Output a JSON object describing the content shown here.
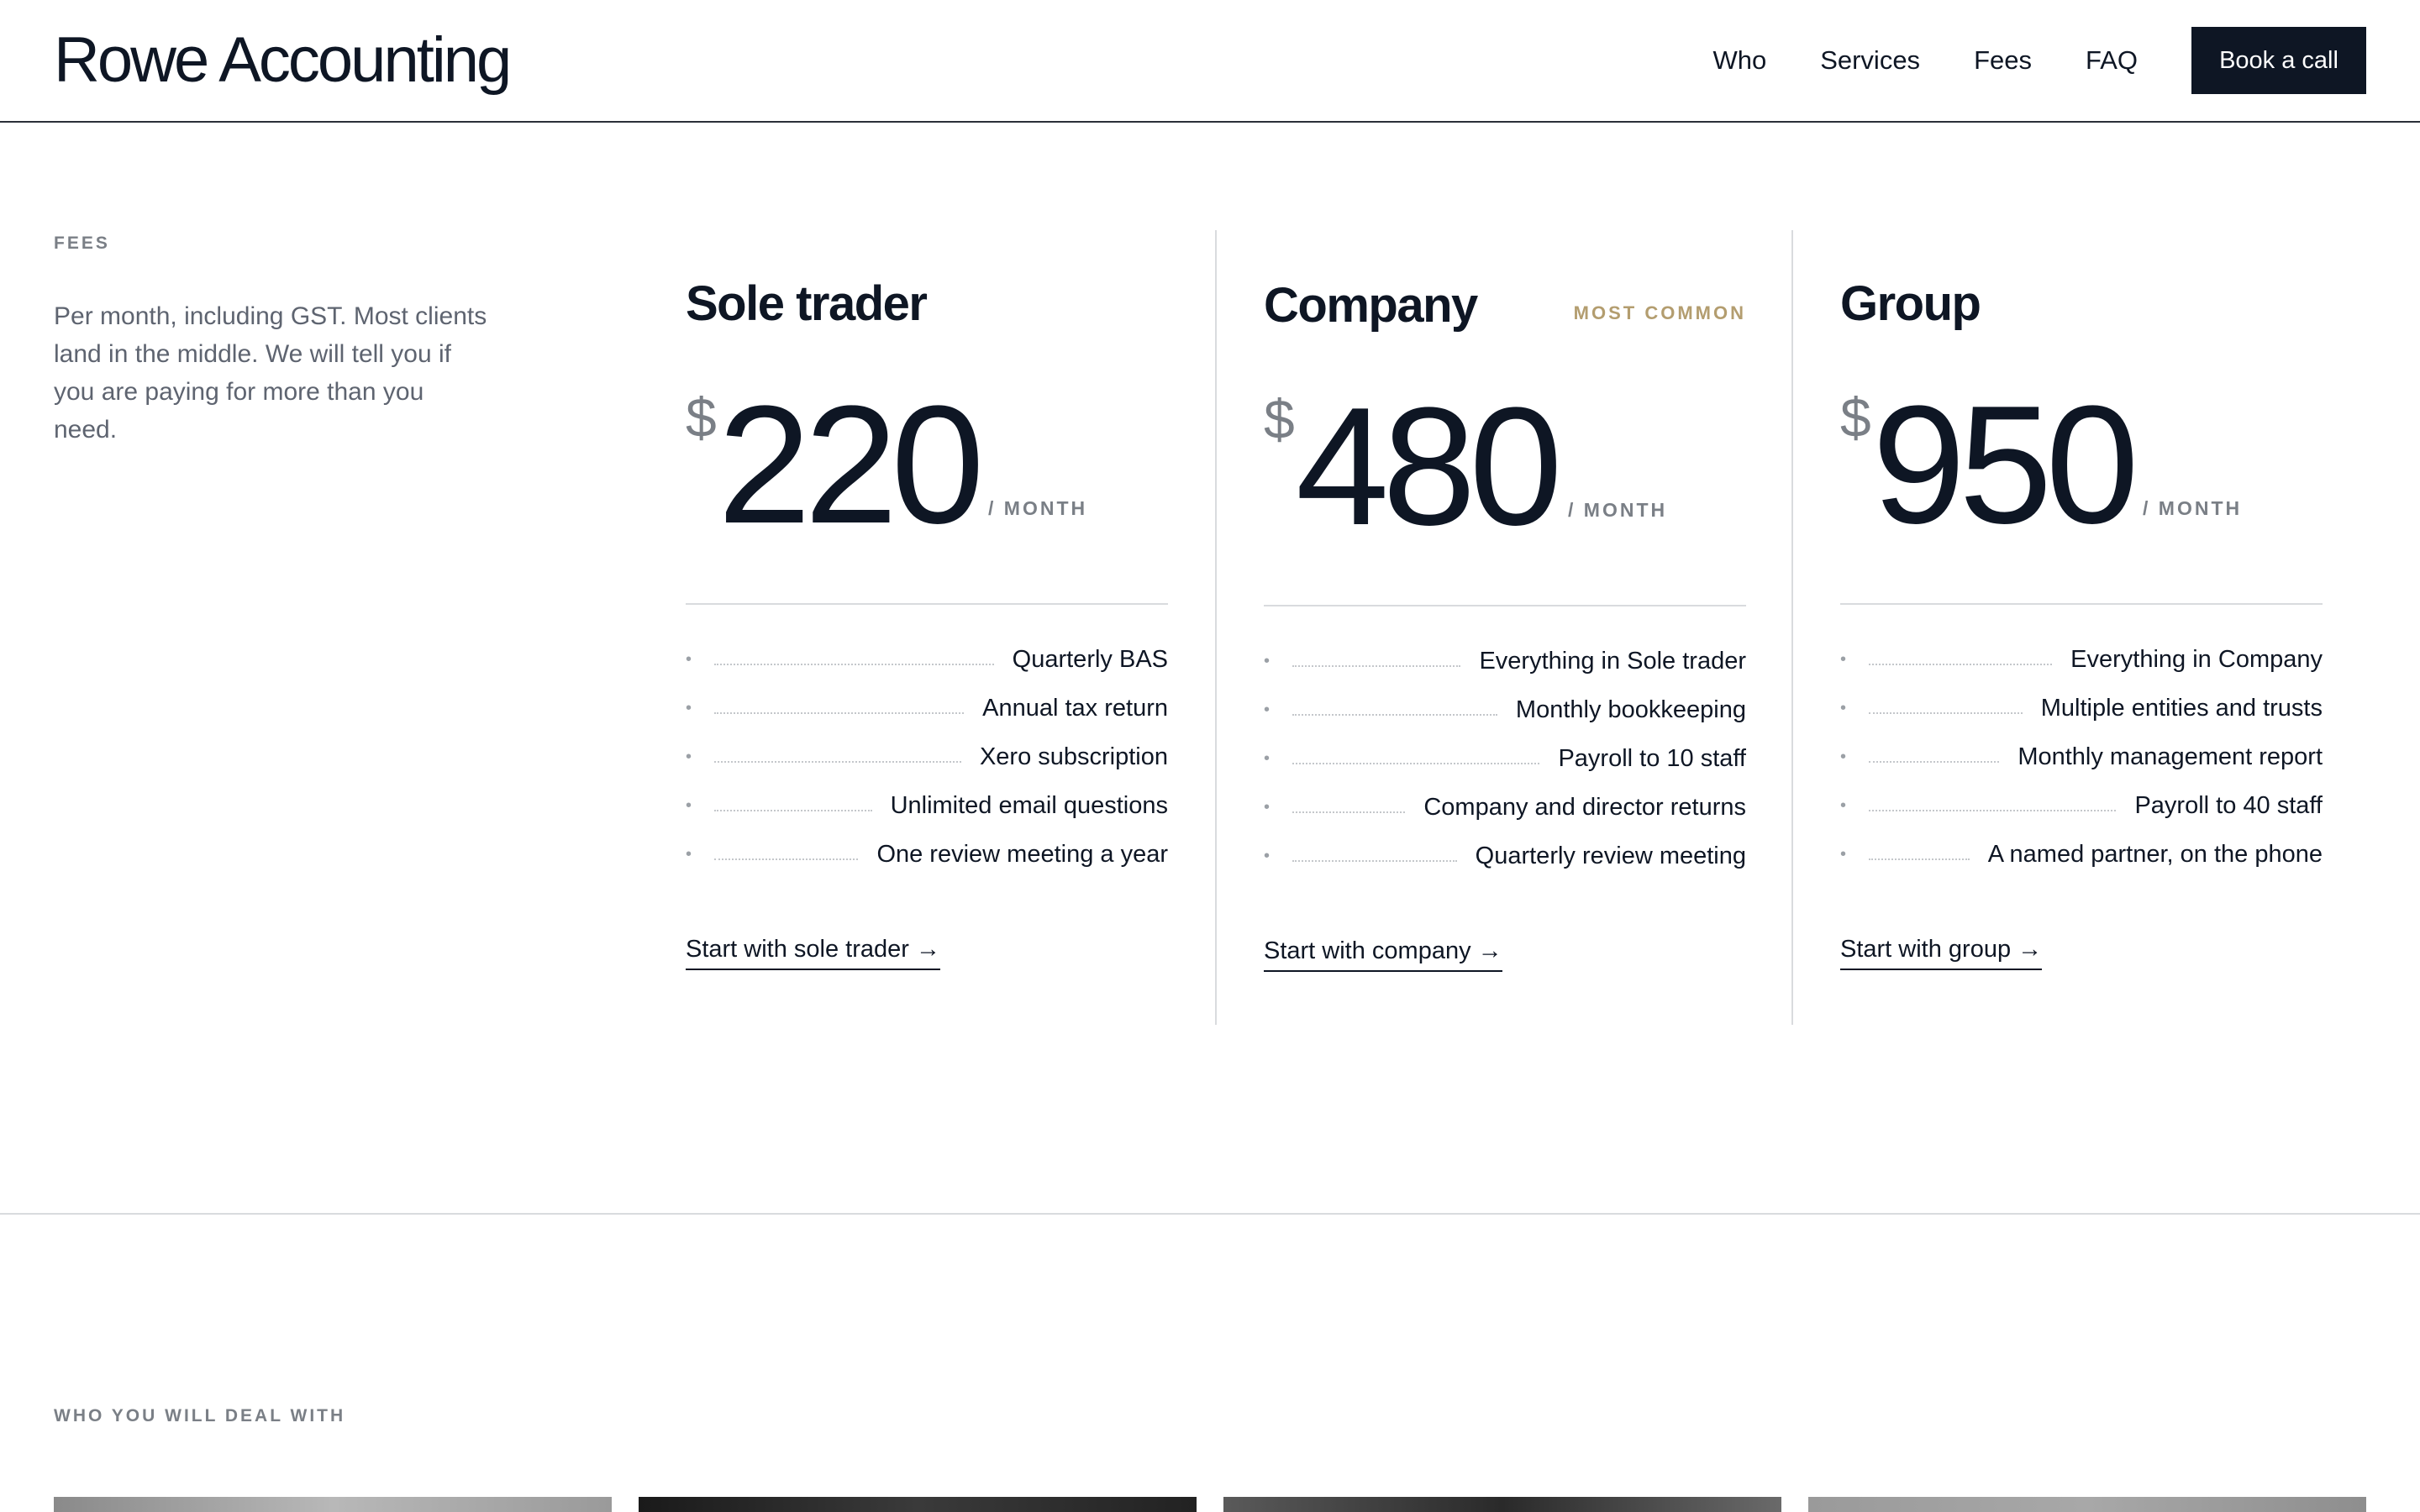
{
  "header": {
    "brand": "Rowe Accounting",
    "nav": [
      "Who",
      "Services",
      "Fees",
      "FAQ"
    ],
    "cta": "Book a call"
  },
  "fees": {
    "eyebrow": "FEES",
    "intro": "Per month, including GST. Most clients land in the middle. We will tell you if you are paying for more than you need.",
    "currency": "$",
    "per": "/ MONTH",
    "plans": [
      {
        "name": "Sole trader",
        "badge": "",
        "price": "220",
        "features": [
          "Quarterly BAS",
          "Annual tax return",
          "Xero subscription",
          "Unlimited email questions",
          "One review meeting a year"
        ],
        "link": "Start with sole trader →"
      },
      {
        "name": "Company",
        "badge": "MOST COMMON",
        "price": "480",
        "features": [
          "Everything in Sole trader",
          "Monthly bookkeeping",
          "Payroll to 10 staff",
          "Company and director returns",
          "Quarterly review meeting"
        ],
        "link": "Start with company →"
      },
      {
        "name": "Group",
        "badge": "",
        "price": "950",
        "features": [
          "Everything in Company",
          "Multiple entities and trusts",
          "Monthly management report",
          "Payroll to 40 staff",
          "A named partner, on the phone"
        ],
        "link": "Start with group →"
      }
    ]
  },
  "team": {
    "eyebrow": "WHO YOU WILL DEAL WITH"
  },
  "colors": {
    "ink": "#0e1624",
    "muted": "#7a7f86",
    "accent": "#b39d6f",
    "rule": "#d9dbde"
  }
}
